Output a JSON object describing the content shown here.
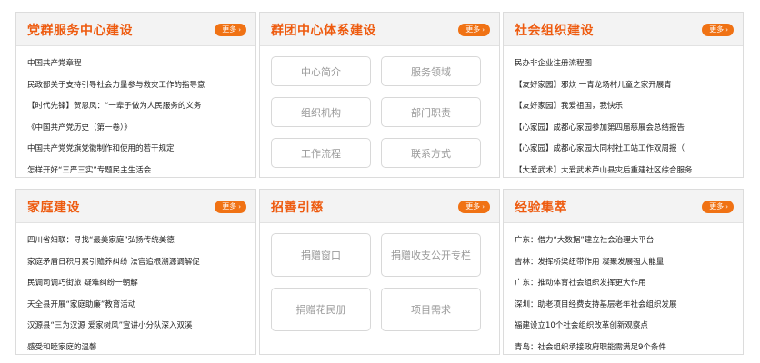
{
  "more_label": "更多",
  "panels": [
    {
      "title": "党群服务中心建设",
      "items": [
        "中国共产党章程",
        "民政部关于支持引导社会力量参与救灾工作的指导意",
        "【时代先锋】贺恩凤：“一辈子做为人民服务的义务",
        "《中国共产党历史（第一卷）》",
        "中国共产党党旗党徽制作和使用的若干规定",
        "怎样开好“三严三实”专题民主生活会"
      ]
    },
    {
      "title": "群团中心体系建设",
      "buttons": [
        "中心简介",
        "服务领域",
        "组织机构",
        "部门职责",
        "工作流程",
        "联系方式"
      ]
    },
    {
      "title": "社会组织建设",
      "items": [
        "民办非企业注册流程图",
        "【友好家园】邪炊 一青龙场村儿童之家开展青",
        "【友好家园】我爱祖国，我快乐",
        "【心家园】成都心家园参加第四届慈展会总结报告",
        "【心家园】成都心家园大同村社工站工作双周报（",
        "【大爱武术】大爱武术芦山县灾后重建社区综合服务"
      ]
    },
    {
      "title": "家庭建设",
      "items": [
        "四川省妇联：寻找“最美家庭”弘扬传统美德",
        "家庭矛盾日积月累引赡养纠纷 法官追根溯源调解促",
        "民调司调巧街旅 疑难纠纷一朝解",
        "天全县开展“家庭助廉”教育活动",
        "汉源县“三为汉源 爱家树风”宣讲小分队深入双溪",
        "感受和睦家庭的温馨"
      ]
    },
    {
      "title": "招善引慈",
      "buttons": [
        "捐赠窗口",
        "捐赠收支公开专栏",
        "捐赠花民册",
        "项目需求"
      ]
    },
    {
      "title": "经验集萃",
      "items": [
        "广东：借力“大数据”建立社会治理大平台",
        "吉林：发挥桥梁纽带作用 凝聚发展强大能量",
        "广东：推动体育社会组织发挥更大作用",
        "深圳：助老项目经费支持基层老年社会组织发展",
        "福建设立10个社会组织改革创新观察点",
        "青岛：社会组织承接政府职能需满足9个条件"
      ]
    }
  ]
}
